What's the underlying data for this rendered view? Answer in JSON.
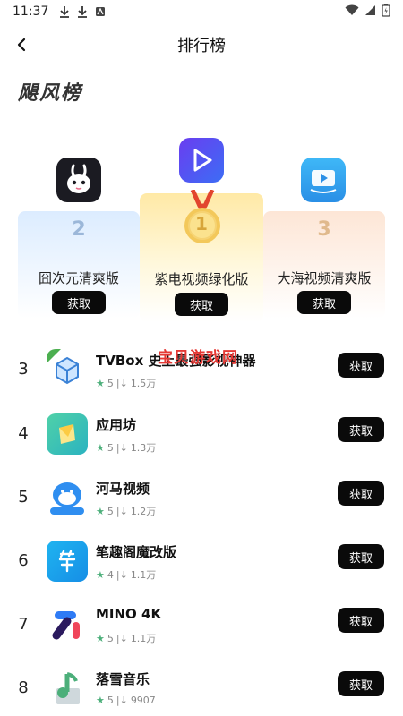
{
  "status_bar": {
    "time": "11:37"
  },
  "nav": {
    "title": "排行榜"
  },
  "section": {
    "title": "飓风榜"
  },
  "podium": [
    {
      "rank": "2",
      "name": "囧次元清爽版",
      "button": "获取",
      "icon": "bunny-app-icon"
    },
    {
      "rank": "1",
      "name": "紫电视频绿化版",
      "button": "获取",
      "icon": "purple-play-app-icon"
    },
    {
      "rank": "3",
      "name": "大海视频清爽版",
      "button": "获取",
      "icon": "blue-tv-app-icon"
    }
  ],
  "list": [
    {
      "rank": "3",
      "name": "TVBox 史上最强影视神器",
      "rating": "5",
      "downloads": "1.5万",
      "button": "获取"
    },
    {
      "rank": "4",
      "name": "应用坊",
      "rating": "5",
      "downloads": "1.3万",
      "button": "获取"
    },
    {
      "rank": "5",
      "name": "河马视频",
      "rating": "5",
      "downloads": "1.2万",
      "button": "获取"
    },
    {
      "rank": "6",
      "name": "笔趣阁魔改版",
      "rating": "4",
      "downloads": "1.1万",
      "button": "获取"
    },
    {
      "rank": "7",
      "name": "MINO 4K",
      "rating": "5",
      "downloads": "1.1万",
      "button": "获取"
    },
    {
      "rank": "8",
      "name": "落雪音乐",
      "rating": "5",
      "downloads": "9907",
      "button": "获取"
    }
  ],
  "watermark": "宝贝游戏网",
  "colors": {
    "button_bg": "#0a0a0a",
    "star": "#4caf7a",
    "rank2": "#9bb7d9",
    "rank1": "#d7a53a",
    "rank3": "#e0b98c",
    "watermark": "#e53935"
  }
}
